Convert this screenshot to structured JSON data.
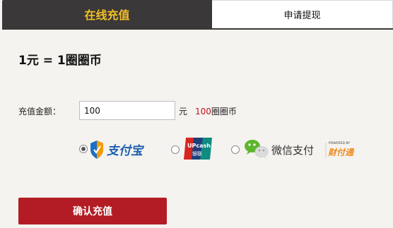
{
  "tabs": {
    "recharge": "在线充值",
    "withdraw": "申请提现"
  },
  "rate": "1元 = 1圈圈币",
  "amount": {
    "label": "充值金额：",
    "value": "100",
    "unit": "元",
    "coins_value": "100",
    "coins_unit": "圈圈币"
  },
  "payment": {
    "alipay_text": "支付宝",
    "unionpay_top": "UPcash",
    "unionpay_bottom": "银联",
    "wechat_text": "微信支付",
    "tenpay_powered": "POWERED BY",
    "tenpay_text": "财付通",
    "selected": "alipay"
  },
  "confirm_label": "确认充值",
  "colors": {
    "tab_active_bg": "#3a3838",
    "tab_active_text": "#f2bf24",
    "confirm_bg": "#b31c24",
    "highlight_red": "#c1121f"
  }
}
